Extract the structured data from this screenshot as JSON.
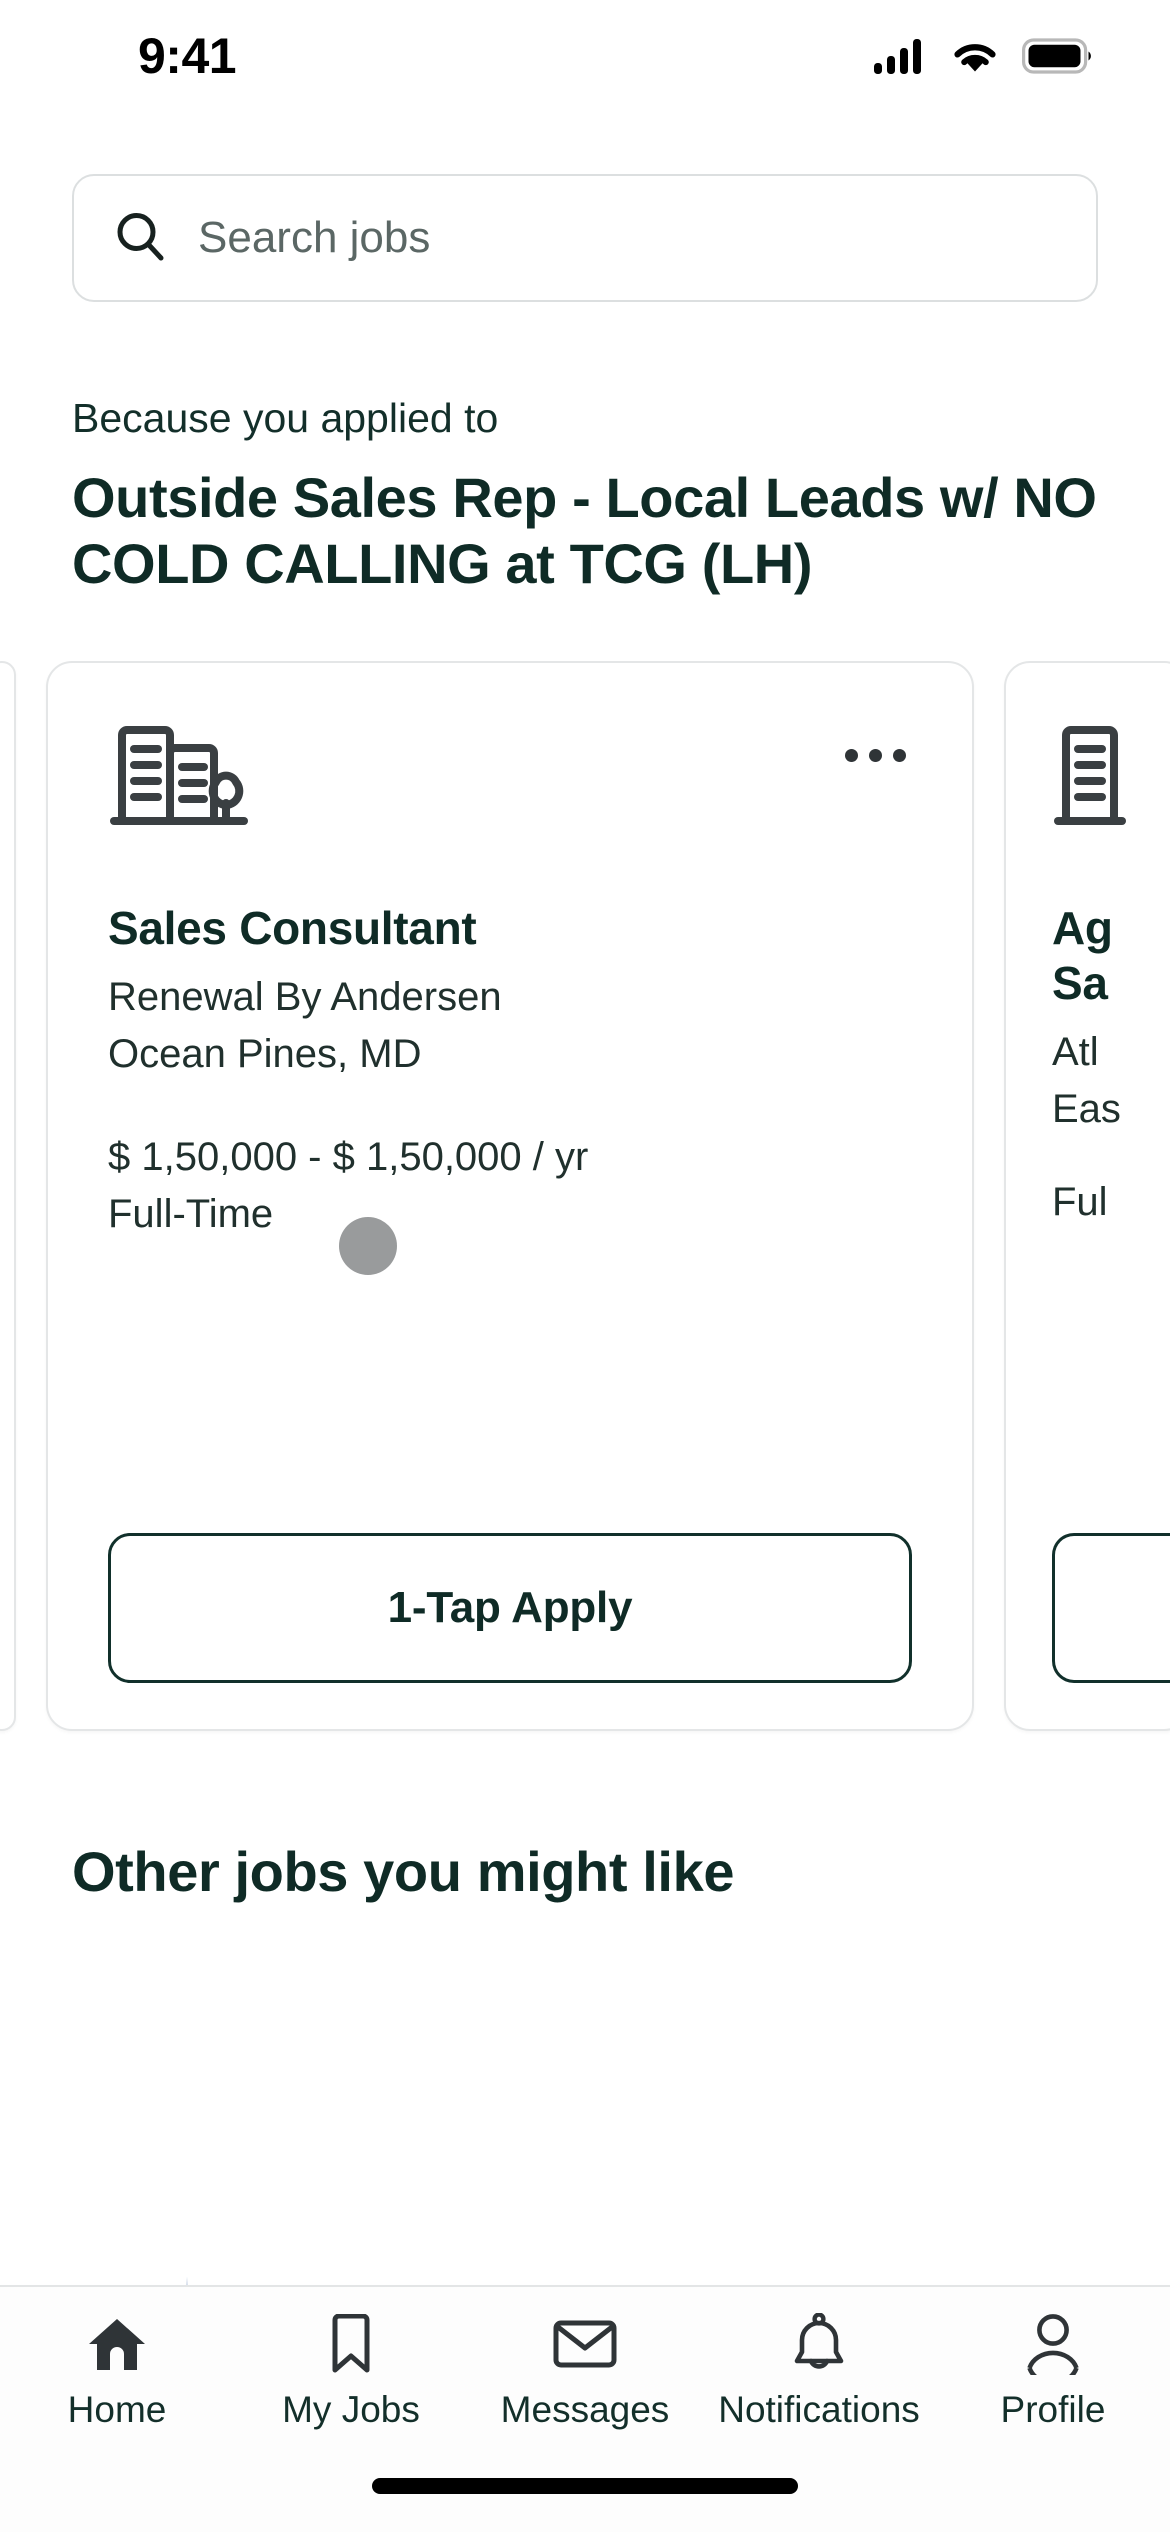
{
  "status_bar": {
    "time": "9:41",
    "icons": [
      "cellular-signal-icon",
      "wifi-icon",
      "battery-icon"
    ]
  },
  "search": {
    "placeholder": "Search jobs",
    "value": "",
    "icon": "search-icon"
  },
  "recommendation": {
    "eyebrow": "Because you applied to",
    "title": "Outside Sales Rep - Local Leads w/ NO COLD CALLING at TCG (LH)"
  },
  "job_carousel": {
    "overflow_icon": "more-options-icon",
    "company_icon": "office-building-icon",
    "cards": [
      {
        "title": "Sales Consultant",
        "company": "Renewal By Andersen",
        "location": "Ocean Pines, MD",
        "pay": "$ 1,50,000 - $ 1,50,000 / yr",
        "employment_type": "Full-Time",
        "apply_label": "1-Tap Apply"
      },
      {
        "title_line1": "Ag",
        "title_line2": "Sa",
        "company": "Atl",
        "location": "Eas",
        "employment_type": "Ful"
      }
    ]
  },
  "other_jobs": {
    "heading": "Other jobs you might like",
    "watermark_icon": "compass-rose-icon"
  },
  "tab_bar": {
    "items": [
      {
        "label": "Home",
        "icon": "home-icon",
        "active": true
      },
      {
        "label": "My Jobs",
        "icon": "bookmark-icon",
        "active": false
      },
      {
        "label": "Messages",
        "icon": "envelope-icon",
        "active": false
      },
      {
        "label": "Notifications",
        "icon": "bell-icon",
        "active": false
      },
      {
        "label": "Profile",
        "icon": "person-icon",
        "active": false
      }
    ]
  },
  "colors": {
    "brand_dark": "#0f2b26",
    "text_body": "#20302d",
    "placeholder": "#5b6765",
    "card_border": "#e4e6e7",
    "icon_dark": "#2f3437",
    "compass": "#b6c4de"
  }
}
